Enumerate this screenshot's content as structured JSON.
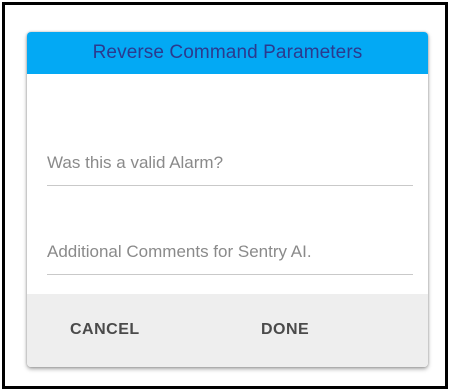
{
  "dialog": {
    "title": "Reverse Command Parameters",
    "fields": {
      "valid_alarm": {
        "placeholder": "Was this a valid Alarm?",
        "value": ""
      },
      "comments": {
        "placeholder": "Additional Comments for Sentry AI.",
        "value": ""
      }
    },
    "actions": {
      "cancel_label": "CANCEL",
      "done_label": "DONE"
    }
  },
  "colors": {
    "title_bar": "#03a9f4",
    "title_text": "#2b3a8e",
    "action_bar": "#eeeeee"
  }
}
